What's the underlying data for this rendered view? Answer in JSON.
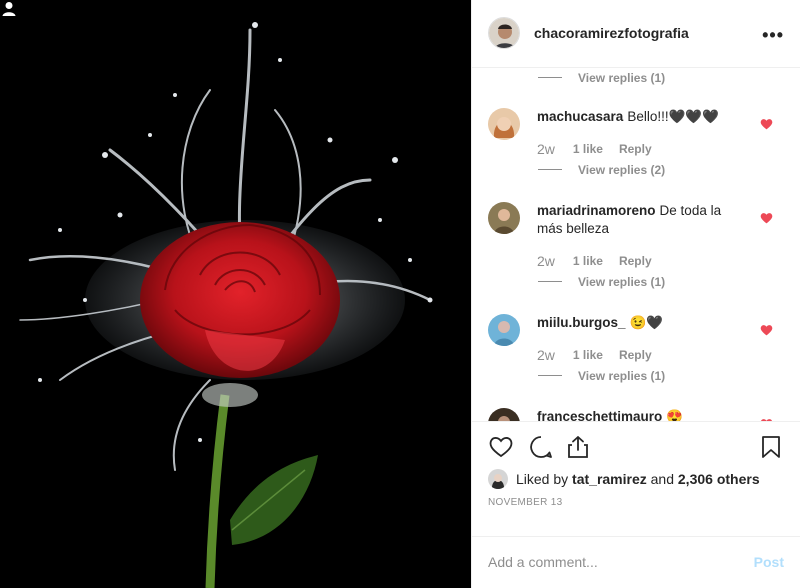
{
  "post": {
    "author": "chacoramirezfotografia",
    "more_icon": "more-horizontal-icon",
    "image": "red rose in water splash"
  },
  "comments": {
    "top_view_replies": "View replies (1)",
    "items": [
      {
        "user": "machucasara",
        "text": "Bello!!!🖤🖤🖤",
        "time": "2w",
        "likes": "1 like",
        "reply": "Reply",
        "view_replies": "View replies (2)",
        "liked": true
      },
      {
        "user": "mariadrinamoreno",
        "text": "De toda la más belleza",
        "time": "2w",
        "likes": "1 like",
        "reply": "Reply",
        "view_replies": "View replies (1)",
        "liked": true
      },
      {
        "user": "miilu.burgos_",
        "text": "😉🖤",
        "time": "2w",
        "likes": "1 like",
        "reply": "Reply",
        "view_replies": "View replies (1)",
        "liked": true
      },
      {
        "user": "franceschettimauro",
        "text": "😍",
        "liked": true
      }
    ]
  },
  "actions": {
    "like_icon": "heart-icon",
    "comment_icon": "comment-icon",
    "share_icon": "share-icon",
    "save_icon": "bookmark-icon"
  },
  "likes": {
    "prefix": "Liked by",
    "user": "tat_ramirez",
    "middle": "and",
    "others": "2,306 others"
  },
  "date": "NOVEMBER 13",
  "add_comment": {
    "placeholder": "Add a comment...",
    "post_label": "Post"
  },
  "colors": {
    "heart_red": "#ed4956",
    "post_disabled": "#b2dffc",
    "muted_text": "#8e8e8e"
  }
}
